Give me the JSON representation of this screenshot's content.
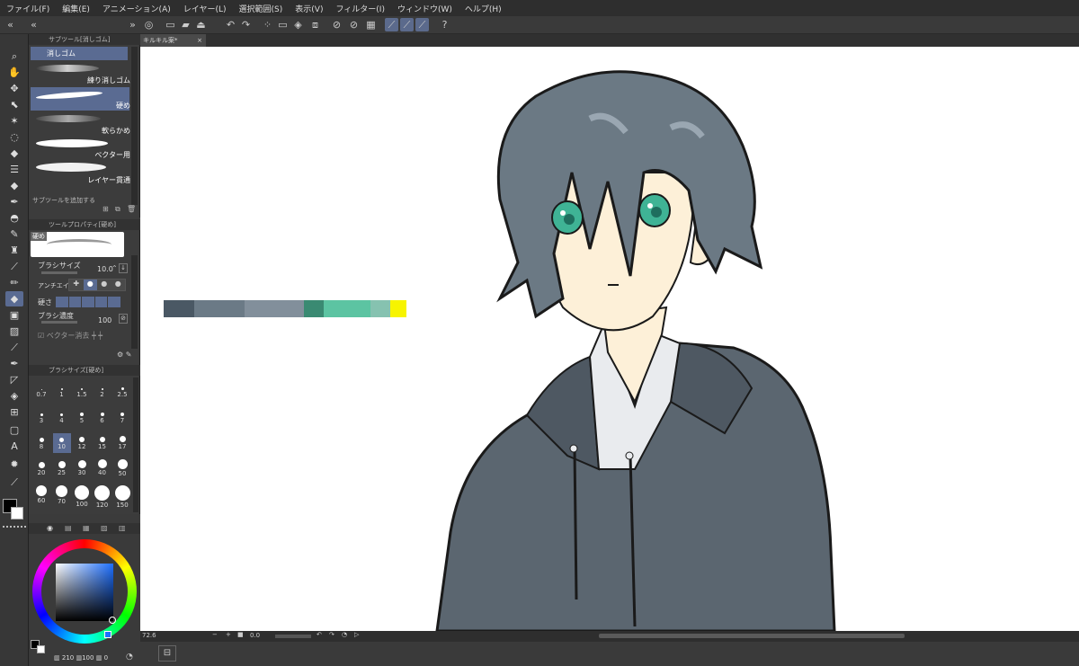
{
  "menu": [
    "ファイル(F)",
    "編集(E)",
    "アニメーション(A)",
    "レイヤー(L)",
    "選択範囲(S)",
    "表示(V)",
    "フィルター(I)",
    "ウィンドウ(W)",
    "ヘルプ(H)"
  ],
  "document_tab": {
    "title": "キルキル案*"
  },
  "subtool_panel": {
    "title": "サブツール[消しゴム]",
    "group": "消しゴム",
    "items": [
      {
        "label": "練り消しゴム"
      },
      {
        "label": "硬め"
      },
      {
        "label": "軟らかめ"
      },
      {
        "label": "ベクター用"
      },
      {
        "label": "レイヤー貫通"
      }
    ],
    "add_label": "サブツールを追加する"
  },
  "tool_property": {
    "title": "ツールプロパティ[硬め]",
    "preset_label": "硬め",
    "brush_size_label": "ブラシサイズ",
    "brush_size_value": "10.0",
    "antialias_label": "アンチエイ",
    "hardness_label": "硬さ",
    "density_label": "ブラシ濃度",
    "density_value": "100",
    "vector_erase_label": "ベクター消去"
  },
  "brush_size_panel": {
    "title": "ブラシサイズ[硬め]",
    "sizes": [
      "0.7",
      "1",
      "1.5",
      "2",
      "2.5",
      "3",
      "4",
      "5",
      "6",
      "7",
      "8",
      "10",
      "12",
      "15",
      "17",
      "20",
      "25",
      "30",
      "40",
      "50",
      "60",
      "70",
      "100",
      "120",
      "150"
    ],
    "selected": "10"
  },
  "color_panel": {
    "readout_h": "210",
    "readout_s": "100",
    "readout_v": "0"
  },
  "statusbar": {
    "zoom": "72.6",
    "angle": "0.0"
  },
  "palette_swatches": [
    "#4a5864",
    "#6b7a86",
    "#828f9b",
    "#3a8a72",
    "#5cc4a2",
    "#86c2b0",
    "#f7f400"
  ],
  "colors": {
    "hoodie": "#5b6670",
    "hair": "#6b7984",
    "skin": "#fdf0d8",
    "eye": "#3fb395",
    "accent": "#5a6b92"
  }
}
